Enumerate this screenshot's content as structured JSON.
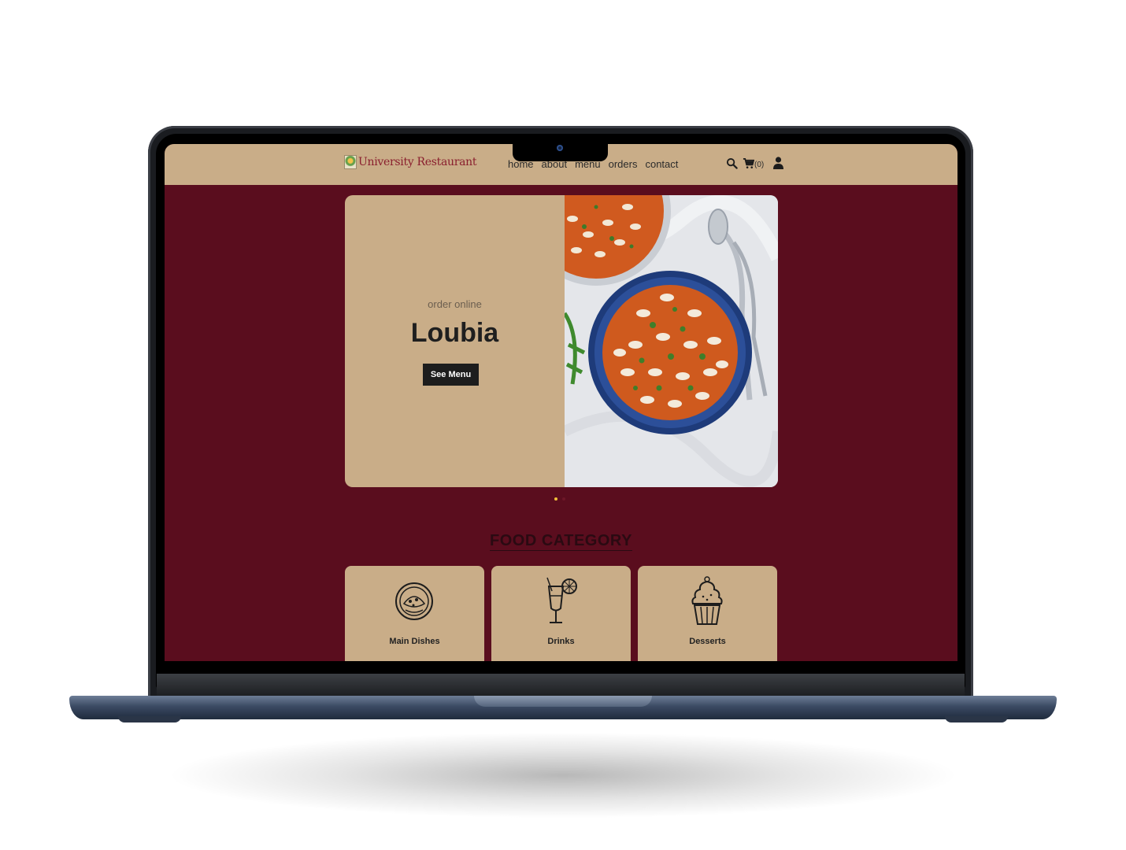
{
  "site": {
    "brand": "University Restaurant",
    "nav": [
      "home",
      "about",
      "menu",
      "orders",
      "contact"
    ],
    "cart_count": "(0)",
    "icons": [
      "search-icon",
      "cart-icon",
      "user-icon"
    ]
  },
  "hero": {
    "subtitle": "order online",
    "title": "Loubia",
    "button": "See Menu",
    "slides_total": 2,
    "active_slide": 1
  },
  "categories": {
    "title": "FOOD CATEGORY",
    "items": [
      {
        "label": "Main Dishes",
        "icon": "main-dish-icon"
      },
      {
        "label": "Drinks",
        "icon": "drink-icon"
      },
      {
        "label": "Desserts",
        "icon": "cupcake-icon"
      }
    ]
  },
  "colors": {
    "page_bg": "#5a0d1e",
    "nav_bg": "#c9ad88",
    "brand_text": "#8a1f2e",
    "button_bg": "#1d1d1d",
    "active_dot": "#f2c13a"
  }
}
